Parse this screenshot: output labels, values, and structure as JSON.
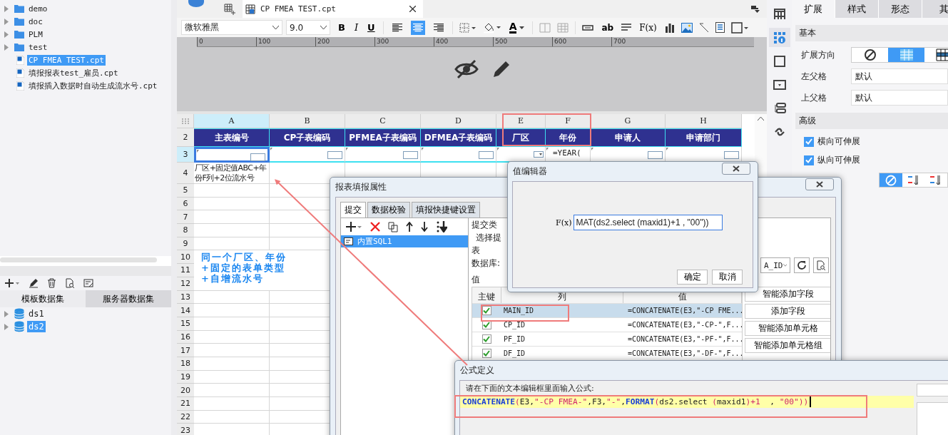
{
  "file_tree": {
    "items": [
      {
        "label": "demo",
        "kind": "folder",
        "selected": false
      },
      {
        "label": "doc",
        "kind": "folder",
        "selected": false
      },
      {
        "label": "PLM",
        "kind": "folder",
        "selected": false
      },
      {
        "label": "test",
        "kind": "folder",
        "selected": false
      },
      {
        "label": "CP FMEA TEST.cpt",
        "kind": "file",
        "selected": true
      },
      {
        "label": "填报报表test_雇员.cpt",
        "kind": "file",
        "selected": false
      },
      {
        "label": "填报插入数据时自动生成流水号.cpt",
        "kind": "file",
        "selected": false
      }
    ]
  },
  "dataset_panel": {
    "tabs": [
      {
        "label": "模板数据集",
        "selected": true
      },
      {
        "label": "服务器数据集",
        "selected": false
      }
    ],
    "items": [
      {
        "label": "ds1",
        "selected": false
      },
      {
        "label": "ds2",
        "selected": true
      }
    ]
  },
  "document_tab": {
    "title": "CP FMEA TEST.cpt"
  },
  "toolbar": {
    "font": "微软雅黑",
    "size": "9.0",
    "format_buttons": [
      {
        "label": "B",
        "kind": "bold"
      },
      {
        "label": "I",
        "kind": "italic"
      },
      {
        "label": "U",
        "kind": "underline"
      }
    ],
    "alignment": [
      {
        "kind": "left",
        "selected": false
      },
      {
        "kind": "center",
        "selected": true
      },
      {
        "kind": "right",
        "selected": false
      }
    ],
    "font_color_label": "A",
    "text_field_label": "ab",
    "formula_label": "F(x)"
  },
  "ruler": {
    "ticks": [
      "0",
      "100",
      "200",
      "300",
      "400",
      "500",
      "600",
      "700"
    ]
  },
  "sheet": {
    "columns": [
      {
        "label": "A",
        "selected": true
      },
      {
        "label": "B",
        "selected": false
      },
      {
        "label": "C",
        "selected": false
      },
      {
        "label": "D",
        "selected": false
      },
      {
        "label": "E",
        "selected": false
      },
      {
        "label": "F",
        "selected": false
      },
      {
        "label": "G",
        "selected": false
      },
      {
        "label": "H",
        "selected": false
      }
    ],
    "rows": [
      {
        "number": "2",
        "kind": "header",
        "cells": [
          {
            "text": "主表编号"
          },
          {
            "text": "CP子表编码"
          },
          {
            "text": "PFMEA子表编码"
          },
          {
            "text": "DFMEA子表编码"
          },
          {
            "text": "厂区"
          },
          {
            "text": "年份"
          },
          {
            "text": "申请人"
          },
          {
            "text": "申请部门"
          }
        ]
      },
      {
        "number": "3",
        "kind": "widgets",
        "cells": [
          {
            "kind": "box",
            "selected": true
          },
          {
            "kind": "box",
            "selected": false
          },
          {
            "kind": "box",
            "selected": false
          },
          {
            "kind": "box",
            "selected": false
          },
          {
            "kind": "dropdown",
            "selected": false
          },
          {
            "kind": "formula",
            "text": "=YEAR(",
            "selected": false
          },
          {
            "kind": "box",
            "selected": false
          },
          {
            "kind": "box",
            "selected": false
          }
        ]
      },
      {
        "number": "4",
        "kind": "text",
        "cells": [
          {
            "text": "厂区+固定值ABC+年份F列+2位流水号"
          }
        ]
      },
      {
        "number": "5",
        "kind": "empty"
      },
      {
        "number": "6",
        "kind": "empty"
      },
      {
        "number": "7",
        "kind": "empty"
      },
      {
        "number": "8",
        "kind": "empty"
      },
      {
        "number": "9",
        "kind": "empty"
      },
      {
        "number": "10",
        "kind": "empty"
      },
      {
        "number": "11",
        "kind": "empty"
      },
      {
        "number": "12",
        "kind": "empty"
      },
      {
        "number": "13",
        "kind": "empty"
      },
      {
        "number": "14",
        "kind": "empty"
      },
      {
        "number": "15",
        "kind": "empty"
      },
      {
        "number": "16",
        "kind": "empty"
      },
      {
        "number": "17",
        "kind": "empty"
      },
      {
        "number": "18",
        "kind": "empty"
      },
      {
        "number": "19",
        "kind": "empty"
      },
      {
        "number": "20",
        "kind": "empty"
      },
      {
        "number": "21",
        "kind": "empty"
      },
      {
        "number": "22",
        "kind": "empty"
      },
      {
        "number": "23",
        "kind": "empty"
      }
    ],
    "note": "同一个厂区、年份+固定的表单类型+自增流水号"
  },
  "side_icons": [
    {
      "kind": "cell",
      "selected": false
    },
    {
      "kind": "attributes",
      "selected": true
    },
    {
      "kind": "border",
      "selected": false
    },
    {
      "kind": "widget",
      "selected": false
    },
    {
      "kind": "condition",
      "selected": false
    },
    {
      "kind": "link",
      "selected": false
    }
  ],
  "right_panel": {
    "tabs": [
      {
        "label": "扩展",
        "selected": true
      },
      {
        "label": "样式",
        "selected": false
      },
      {
        "label": "形态",
        "selected": false
      },
      {
        "label": "其",
        "selected": false
      }
    ],
    "basic_heading": "基本",
    "direction_label": "扩展方向",
    "direction_options": [
      {
        "kind": "none",
        "selected": false
      },
      {
        "kind": "vertical",
        "selected": true
      },
      {
        "kind": "horizontal",
        "selected": false
      }
    ],
    "left_parent_label": "左父格",
    "left_parent_value": "默认",
    "top_parent_label": "上父格",
    "top_parent_value": "默认",
    "advanced_heading": "高级",
    "checkboxes": [
      {
        "label": "横向可伸展",
        "checked": true
      },
      {
        "label": "纵向可伸展",
        "checked": true
      }
    ],
    "sort_options": [
      {
        "kind": "none",
        "selected": true
      },
      {
        "kind": "ascending",
        "selected": false
      },
      {
        "kind": "descending",
        "selected": false
      }
    ]
  },
  "fill_dialog": {
    "title": "报表填报属性",
    "tabs": [
      {
        "label": "提交",
        "selected": true
      },
      {
        "label": "数据校验",
        "selected": false
      },
      {
        "label": "填报快捷键设置",
        "selected": false
      }
    ],
    "list_items": [
      {
        "label": "内置SQL1",
        "selected": true
      }
    ],
    "submit_type_label": "提交类",
    "select_label": "选择提",
    "table_label": "表",
    "database_label": "数据库:",
    "table_value": "A_ID",
    "value_label": "值",
    "columns": [
      "主键",
      "列",
      "值"
    ],
    "rows": [
      {
        "checked": true,
        "column": "MAIN_ID",
        "value": "=CONCATENATE(E3,\"-CP FME...",
        "selected": true
      },
      {
        "checked": true,
        "column": "CP_ID",
        "value": "=CONCATENATE(E3,\"-CP-\",F...",
        "selected": false
      },
      {
        "checked": true,
        "column": "PF_ID",
        "value": "=CONCATENATE(E3,\"-PF-\",F...",
        "selected": false
      },
      {
        "checked": true,
        "column": "DF_ID",
        "value": "=CONCATENATE(E3,\"-DF-\",F...",
        "selected": false
      }
    ],
    "buttons": [
      "智能添加字段",
      "添加字段",
      "智能添加单元格",
      "智能添加单元格组"
    ]
  },
  "value_editor": {
    "title": "值编辑器",
    "fx_label": "F(x)",
    "value": "MAT(ds2.select (maxid1)+1  , \"00\"))",
    "buttons": [
      "确定",
      "取消"
    ]
  },
  "formula_dialog": {
    "title": "公式定义",
    "prompt": "请在下面的文本编辑框里面输入公式:",
    "tokens": [
      {
        "text": "CONCATENATE",
        "kind": "function"
      },
      {
        "text": "(",
        "kind": "paren"
      },
      {
        "text": "E3,",
        "kind": "plain"
      },
      {
        "text": "\"-CP FMEA-\"",
        "kind": "string"
      },
      {
        "text": ",F3,",
        "kind": "plain"
      },
      {
        "text": "\"-\"",
        "kind": "string"
      },
      {
        "text": ",",
        "kind": "plain"
      },
      {
        "text": "FORMAT",
        "kind": "function"
      },
      {
        "text": "(",
        "kind": "paren"
      },
      {
        "text": "ds2.select ",
        "kind": "plain"
      },
      {
        "text": "(",
        "kind": "paren"
      },
      {
        "text": "maxid1",
        "kind": "plain"
      },
      {
        "text": ")",
        "kind": "paren"
      },
      {
        "text": "+1",
        "kind": "operator"
      },
      {
        "text": "  , ",
        "kind": "plain"
      },
      {
        "text": "\"00\"",
        "kind": "string"
      },
      {
        "text": "))",
        "kind": "paren"
      }
    ]
  }
}
